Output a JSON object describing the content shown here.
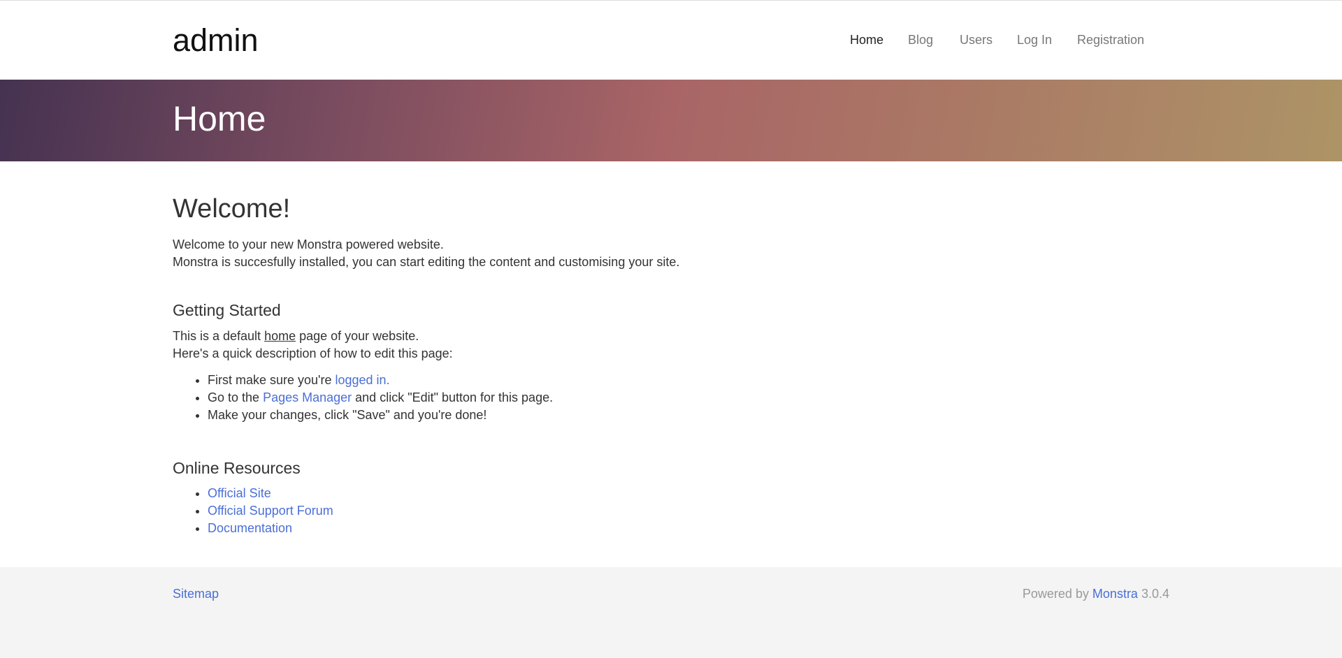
{
  "header": {
    "brand": "admin",
    "nav": [
      "Home",
      "Blog",
      "Users",
      "Log In",
      "Registration"
    ]
  },
  "hero": {
    "title": "Home"
  },
  "welcome": {
    "title": "Welcome!",
    "line1": "Welcome to your new Monstra powered website.",
    "line2": "Monstra is succesfully installed, you can start editing the content and customising your site."
  },
  "getting_started": {
    "title": "Getting Started",
    "intro_pre": "This is a default ",
    "intro_link": "home",
    "intro_post": " page of your website.",
    "line2": "Here's a quick description of how to edit this page:",
    "steps": [
      {
        "pre": "First make sure you're ",
        "link": "logged in.",
        "post": ""
      },
      {
        "pre": "Go to the ",
        "link": "Pages Manager",
        "post": " and click \"Edit\" button for this page."
      },
      {
        "pre": "Make your changes, click \"Save\" and you're done!",
        "link": "",
        "post": ""
      }
    ]
  },
  "online_resources": {
    "title": "Online Resources",
    "links": [
      "Official Site",
      "Official Support Forum",
      "Documentation"
    ]
  },
  "footer": {
    "sitemap": "Sitemap",
    "powered_pre": "Powered by ",
    "powered_link": "Monstra",
    "version": " 3.0.4"
  },
  "colors": {
    "link": "#4a6fd6",
    "hero_gradient": [
      "#453251",
      "#a96566",
      "#ad9466"
    ],
    "footer_bg": "#f4f4f4"
  }
}
